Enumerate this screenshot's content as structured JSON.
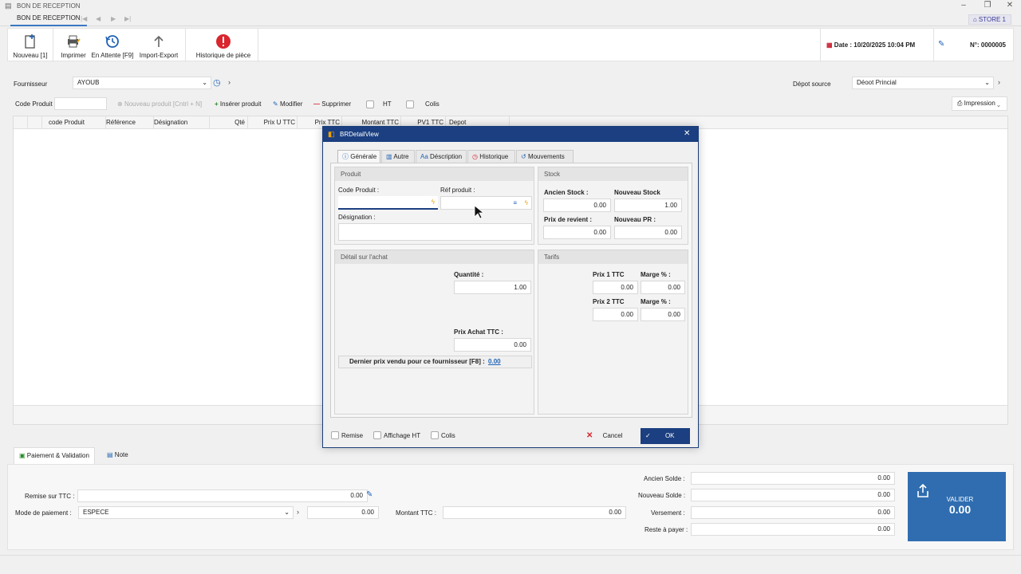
{
  "window": {
    "title": "BON DE RECEPTION",
    "tab": "BON DE RECEPTION",
    "store": "STORE 1"
  },
  "toolbar": {
    "nouveau": "Nouveau [1]",
    "imprimer": "Imprimer",
    "en_attente": "En Attente [F9]",
    "import_export": "Import-Export",
    "historique": "Historique de pièce",
    "date": "Date : 10/20/2025 10:04 PM",
    "numero": "N°: 0000005"
  },
  "form": {
    "fournisseur_label": "Fournisseur",
    "fournisseur_value": "AYOUB",
    "depot_label": "Dépot source",
    "depot_value": "Déoot Princial",
    "code_produit_label": "Code Produit",
    "nouveau_produit": "Nouveau produit [Cntrl + N]",
    "inserer_produit": "Insérer produit",
    "modifier": "Modifier",
    "supprimer": "Supprimer",
    "ht": "HT",
    "colis": "Colis",
    "impression": "Impression"
  },
  "grid": {
    "columns": [
      "code Produit",
      "Référence",
      "Désignation",
      "Qté",
      "Prix U TTC",
      "Prix TTC",
      "Montant TTC",
      "PV1 TTC",
      "Depot"
    ]
  },
  "bottom": {
    "tab_paiement": "Paiement & Validation",
    "tab_note": "Note",
    "remise_label": "Remise sur TTC :",
    "remise_value": "0.00",
    "mode_label": "Mode de paiement :",
    "mode_value": "ESPECE",
    "mode_amount": "0.00",
    "montant_label": "Montant TTC :",
    "montant_value": "0.00",
    "ancien_solde_label": "Ancien Solde :",
    "ancien_solde_value": "0.00",
    "nouveau_solde_label": "Nouveau Solde :",
    "nouveau_solde_value": "0.00",
    "versement_label": "Versement :",
    "versement_value": "0.00",
    "reste_label": "Reste à payer :",
    "reste_value": "0.00",
    "valider_label": "VALIDER",
    "valider_amount": "0.00"
  },
  "dialog": {
    "title": "BRDetailView",
    "tabs": [
      "Générale",
      "Autre",
      "Déscription",
      "Historique",
      "Mouvements"
    ],
    "produit": {
      "header": "Produit",
      "code_label": "Code Produit :",
      "ref_label": "Réf produit :",
      "designation_label": "Désignation :"
    },
    "stock": {
      "header": "Stock",
      "ancien_label": "Ancien Stock :",
      "ancien_value": "0.00",
      "nouveau_label": "Nouveau Stock",
      "nouveau_value": "1.00",
      "revient_label": "Prix de revient :",
      "revient_value": "0.00",
      "pr_label": "Nouveau PR :",
      "pr_value": "0.00"
    },
    "achat": {
      "header": "Détail sur l'achat",
      "quantite_label": "Quantité :",
      "quantite_value": "1.00",
      "prix_achat_label": "Prix Achat TTC :",
      "prix_achat_value": "0.00",
      "dernier_prix_label": "Dernier prix vendu pour ce fournisseur [F8] :",
      "dernier_prix_value": "0.00"
    },
    "tarifs": {
      "header": "Tarifs",
      "prix1_label": "Prix 1 TTC",
      "prix1_value": "0.00",
      "marge1_label": "Marge % :",
      "marge1_value": "0.00",
      "prix2_label": "Prix 2 TTC",
      "prix2_value": "0.00",
      "marge2_label": "Marge % :",
      "marge2_value": "0.00"
    },
    "footer": {
      "remise": "Remise",
      "affichage_ht": "Affichage HT",
      "colis": "Colis",
      "cancel": "Cancel",
      "ok": "OK"
    }
  },
  "colors": {
    "accent": "#1b3f80",
    "valider_bg": "#2f6db0",
    "error_red": "#d9262f",
    "orange": "#f0a000",
    "link": "#1f62b5"
  }
}
